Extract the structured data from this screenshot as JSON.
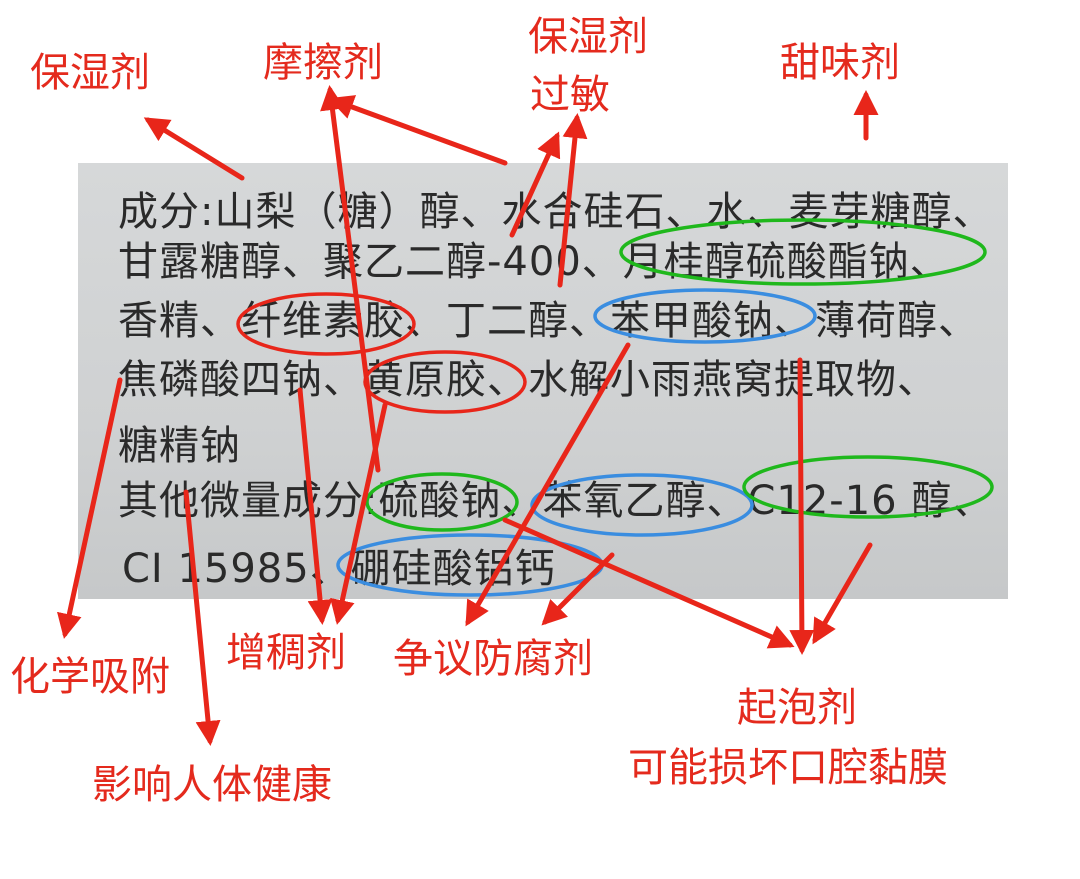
{
  "ingredients": {
    "line1": "成分:山梨（糖）醇、水合硅石、水、麦芽糖醇、",
    "line2": "甘露糖醇、聚乙二醇-400、月桂醇硫酸酯钠、",
    "line3": "香精、纤维素胶、丁二醇、苯甲酸钠、薄荷醇、",
    "line4": "焦磷酸四钠、黄原胶、水解小雨燕窝提取物、",
    "line5": "糖精钠",
    "line6": "其他微量成分:硫酸钠、苯氧乙醇、C12-16 醇、",
    "line7": "CI 15985、硼硅酸铝钙"
  },
  "labels": {
    "humectant": "保湿剂",
    "abrasive": "摩擦剂",
    "humectant_allergy_1": "保湿剂",
    "humectant_allergy_2": "过敏",
    "sweetener": "甜味剂",
    "chemical_adsorption": "化学吸附",
    "thickener": "增稠剂",
    "controversial_preservative": "争议防腐剂",
    "foaming_agent": "起泡剂",
    "mucosa_damage": "可能损坏口腔黏膜",
    "health_impact": "影响人体健康"
  },
  "colors": {
    "annotation_red": "#e42a1d",
    "ellipse_red": "#e8261a",
    "ellipse_green": "#1fb81c",
    "ellipse_blue": "#3a8de0"
  }
}
